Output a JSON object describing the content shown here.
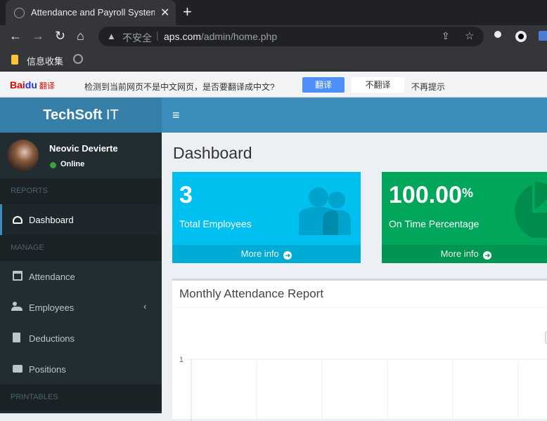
{
  "browser": {
    "tab_title": "Attendance and Payroll System",
    "tab_close": "✕",
    "new_tab": "+",
    "nav_back": "←",
    "nav_forward": "→",
    "nav_reload": "↻",
    "nav_home": "⌂",
    "security_label": "不安全",
    "url_host": "aps.com",
    "url_path": "/admin/home.php",
    "bookmark_label": "信息收集"
  },
  "translate_bar": {
    "brand_bai": "Bai",
    "brand_du": "du",
    "brand_fy": "翻译",
    "message": "检测到当前网页不是中文网页，是否要翻译成中文?",
    "translate_button": "翻译",
    "no_translate_button": "不翻译",
    "no_remind": "不再提示"
  },
  "app": {
    "logo_bold": "TechSoft",
    "logo_light": " IT",
    "menu_icon": "≡"
  },
  "user": {
    "name": "Neovic Devierte",
    "status": "Online"
  },
  "sidebar": {
    "sections": [
      {
        "header": "REPORTS"
      },
      {
        "header": "MANAGE"
      },
      {
        "header": "PRINTABLES"
      }
    ],
    "items": [
      {
        "label": "Dashboard",
        "icon": "dashboard-icon"
      },
      {
        "label": "Attendance",
        "icon": "calendar-icon"
      },
      {
        "label": "Employees",
        "icon": "users-icon"
      },
      {
        "label": "Deductions",
        "icon": "file-icon"
      },
      {
        "label": "Positions",
        "icon": "briefcase-icon"
      }
    ],
    "employees_chevron": "‹"
  },
  "main": {
    "title": "Dashboard",
    "stat_boxes": [
      {
        "value": "3",
        "suffix": "",
        "caption": "Total Employees",
        "link": "More info",
        "color": "#00c0ef"
      },
      {
        "value": "100.00",
        "suffix": "%",
        "caption": "On Time Percentage",
        "link": "More info",
        "color": "#00a65a"
      }
    ],
    "report": {
      "title": "Monthly Attendance Report"
    }
  },
  "chart_data": {
    "type": "bar",
    "title": "",
    "categories": [],
    "series": [],
    "ytick_labels": [
      "1"
    ],
    "grid": true
  },
  "colors": {
    "header": "#3c8dbc",
    "sidebar": "#222d32",
    "aqua": "#00c0ef",
    "green": "#00a65a"
  }
}
